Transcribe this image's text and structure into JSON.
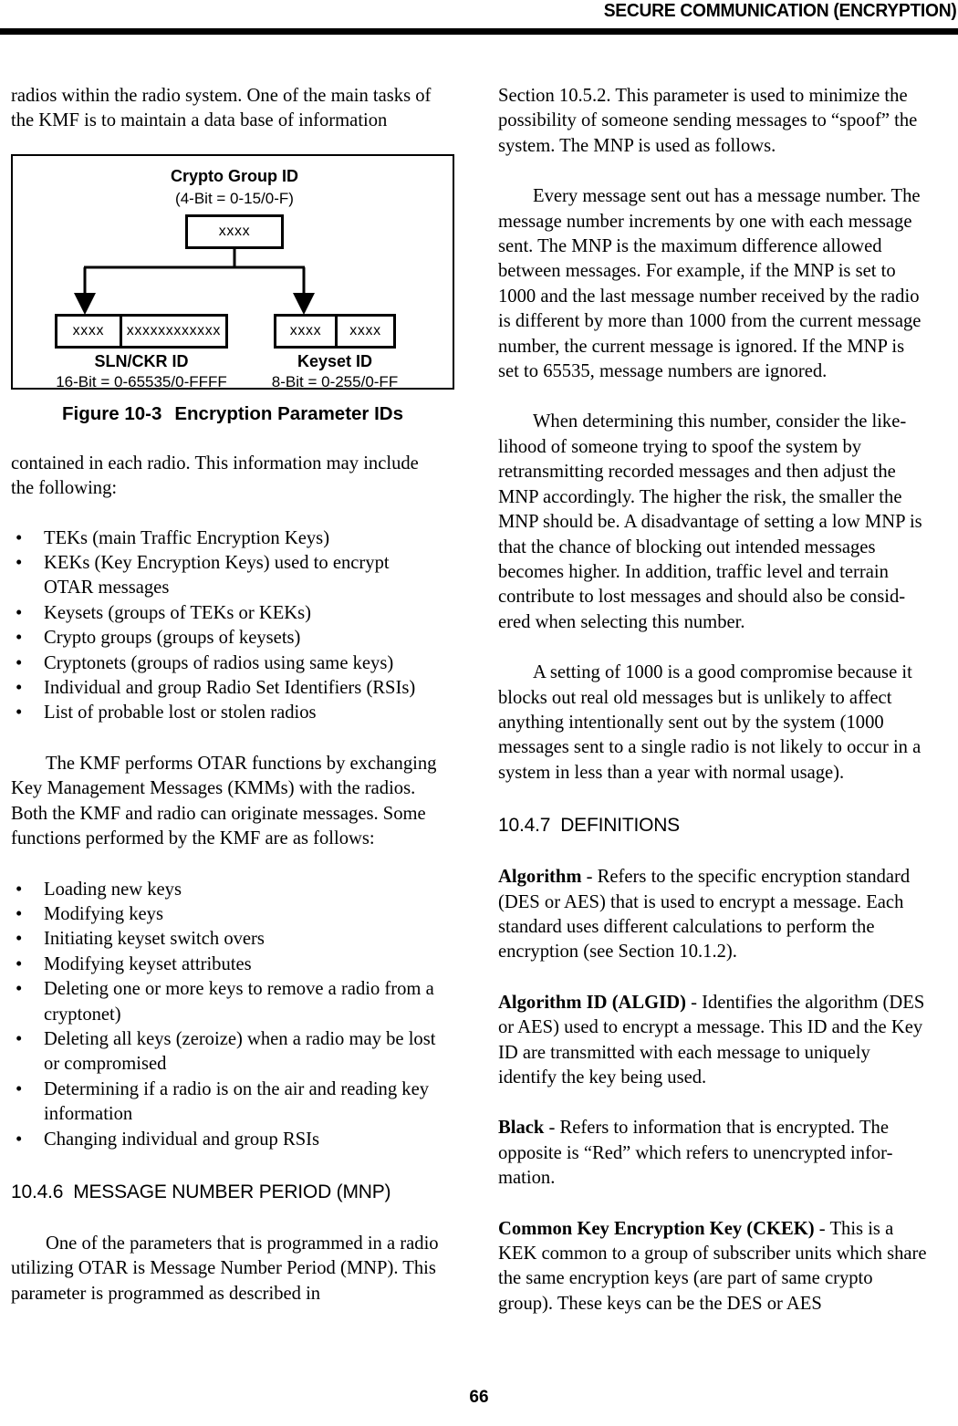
{
  "header": {
    "title": "SECURE COMMUNICATION (ENCRYPTION)"
  },
  "footer": {
    "page_number": "66"
  },
  "left_column": {
    "para_continued": "radios within the radio system. One of the main tasks of the KMF is to maintain a data base of information",
    "figure": {
      "top_title": "Crypto Group ID",
      "top_subtitle": "(4-Bit = 0-15/0-F)",
      "top_box_value": "xxxx",
      "left_box_cell1": "xxxx",
      "left_box_cell2": "xxxxxxxxxxxx",
      "left_label_title": "SLN/CKR ID",
      "left_label_subtitle": "16-Bit = 0-65535/0-FFFF",
      "right_box_cell1": "xxxx",
      "right_box_cell2": "xxxx",
      "right_label_title": "Keyset ID",
      "right_label_subtitle": "8-Bit = 0-255/0-FF",
      "caption_number": "Figure 10-3",
      "caption_text": "Encryption Parameter IDs"
    },
    "para_after_figure": "contained in each radio. This information may include the following:",
    "list_radio_info": [
      "TEKs (main Traffic Encryption Keys)",
      "KEKs (Key Encryption Keys) used to encrypt OTAR messages",
      "Keysets (groups of TEKs or KEKs)",
      "Crypto groups (groups of keysets)",
      "Cryptonets (groups of radios using same keys)",
      "Individual and group Radio Set Identifiers (RSIs)",
      "List of probable lost or stolen radios"
    ],
    "para_kmf_otar": "The KMF performs OTAR functions by exchanging Key Management Messages (KMMs) with the radios. Both the KMF and radio can originate messages. Some functions performed by the KMF are as follows:",
    "list_kmf_functions": [
      "Loading new keys",
      "Modifying keys",
      "Initiating keyset switch overs",
      "Modifying keyset attributes",
      "Deleting one or more keys to remove a radio from a cryptonet)",
      "Deleting all keys (zeroize) when a radio may be lost or compromised",
      "Determining if a radio is on the air and reading key information",
      "Changing individual and group RSIs"
    ],
    "heading_mnp": {
      "number": "10.4.6",
      "title": "MESSAGE NUMBER PERIOD (MNP)"
    },
    "para_mnp_intro": "One of the parameters that is programmed in a radio utilizing OTAR is Message Number Period (MNP). This parameter is programmed as described in"
  },
  "right_column": {
    "para_mnp_continued": "Section 10.5.2. This parameter is used to minimize the possibility of someone sending messages to “spoof” the system. The MNP is used as follows.",
    "para_message_number": "Every message sent out has a message number. The message number increments by one with each message sent. The MNP is the maximum difference allowed between messages. For example, if the MNP is set to 1000 and the last message number received by the radio is different by more than 1000 from the current message number, the current message is ignored. If the MNP is set to 65535, message numbers are ignored.",
    "para_determining": "When determining this number, consider the like-lihood of someone trying to spoof the system by retransmitting recorded messages and then adjust the MNP accordingly. The higher the risk, the smaller the MNP should be. A disadvantage of setting a low MNP is that the chance of blocking out intended messages becomes higher. In addition, traffic level and terrain contribute to lost messages and should also be consid-ered when selecting this number.",
    "para_setting_1000": "A setting of 1000 is a good compromise because it blocks out real old messages but is unlikely to affect anything intentionally sent out by the system (1000 messages sent to a single radio is not likely to occur in a system in less than a year with normal usage).",
    "heading_definitions": {
      "number": "10.4.7",
      "title": "DEFINITIONS"
    },
    "definitions": [
      {
        "term": "Algorithm",
        "body": " - Refers to the specific encryption standard (DES or AES) that is used to encrypt a message. Each standard uses different calculations to perform the encryption (see Section 10.1.2)."
      },
      {
        "term": "Algorithm ID (ALGID)",
        "body": " - Identifies the algorithm (DES or AES) used to encrypt a message. This ID and the Key ID are transmitted with each message to uniquely identify the key being used."
      },
      {
        "term": "Black",
        "body": " - Refers to information that is encrypted. The opposite is “Red” which refers to unencrypted infor-mation."
      },
      {
        "term": "Common Key Encryption Key (CKEK)",
        "body": " - This is a KEK common to a group of subscriber units which share the same encryption keys (are part of same crypto group). These keys can be the DES or AES"
      }
    ]
  }
}
